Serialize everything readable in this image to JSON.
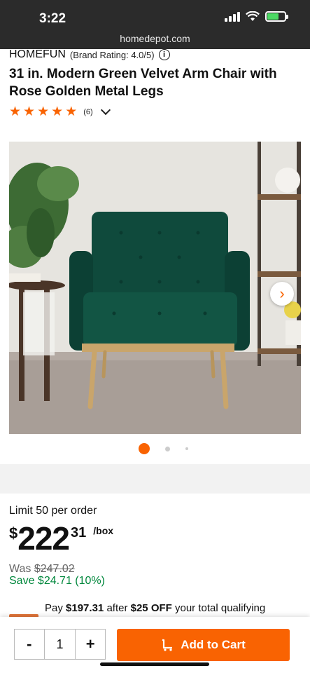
{
  "status_bar": {
    "time": "3:22",
    "url": "homedepot.com"
  },
  "product": {
    "brand": "HOMEFUN",
    "brand_rating": "(Brand Rating: 4.0/5)",
    "title": "31 in. Modern Green Velvet Arm Chair with Rose Golden Metal Legs",
    "stars": 5,
    "review_count": "(6)"
  },
  "gallery": {
    "current_image": 1,
    "total_dots": 3
  },
  "pricing": {
    "limit": "Limit 50 per order",
    "currency": "$",
    "dollars": "222",
    "cents": "31",
    "unit": "/box",
    "was_label": "Was",
    "was_price": "$247.02",
    "save": "Save $24.71 (10%)"
  },
  "promo": {
    "prefix": "Pay",
    "amount": "$197.31",
    "mid": "after",
    "discount": "$25 OFF",
    "suffix": "your total qualifying"
  },
  "cart": {
    "minus": "-",
    "quantity": "1",
    "plus": "+",
    "add_label": "Add to Cart"
  },
  "colors": {
    "accent": "#f96302",
    "save_green": "#00873c",
    "chair": "#0f4a3c"
  }
}
